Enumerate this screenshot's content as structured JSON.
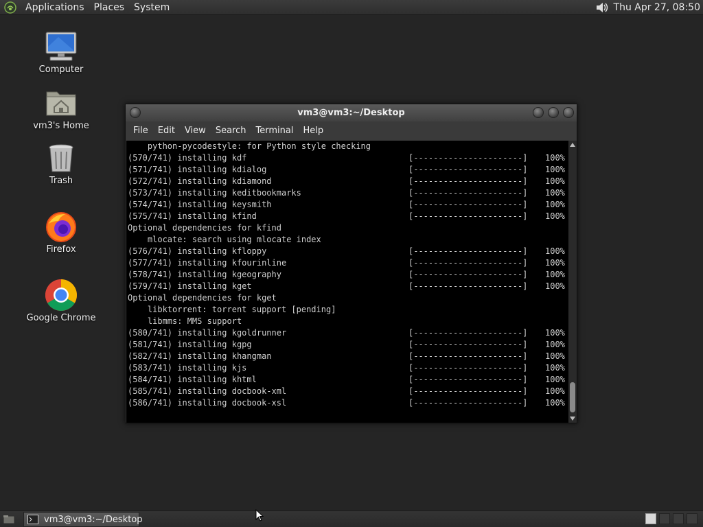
{
  "top_panel": {
    "menus": [
      "Applications",
      "Places",
      "System"
    ],
    "clock": "Thu Apr 27, 08:50",
    "icons": [
      "gnome-foot-icon",
      "volume-icon"
    ]
  },
  "desktop": {
    "icons": [
      {
        "label": "Computer",
        "icon": "computer-icon"
      },
      {
        "label": "vm3's Home",
        "icon": "home-folder-icon"
      },
      {
        "label": "Trash",
        "icon": "trash-icon"
      },
      {
        "label": "Firefox",
        "icon": "firefox-icon"
      },
      {
        "label": "Google Chrome",
        "icon": "chrome-icon"
      }
    ]
  },
  "terminal": {
    "title": "vm3@vm3:~/Desktop",
    "menu": [
      "File",
      "Edit",
      "View",
      "Search",
      "Terminal",
      "Help"
    ],
    "lines": [
      {
        "text": "    python-pycodestyle: for Python style checking",
        "bar": "",
        "pct": ""
      },
      {
        "text": "(570/741) installing kdf",
        "bar": "[----------------------]",
        "pct": "100%"
      },
      {
        "text": "(571/741) installing kdialog",
        "bar": "[----------------------]",
        "pct": "100%"
      },
      {
        "text": "(572/741) installing kdiamond",
        "bar": "[----------------------]",
        "pct": "100%"
      },
      {
        "text": "(573/741) installing keditbookmarks",
        "bar": "[----------------------]",
        "pct": "100%"
      },
      {
        "text": "(574/741) installing keysmith",
        "bar": "[----------------------]",
        "pct": "100%"
      },
      {
        "text": "(575/741) installing kfind",
        "bar": "[----------------------]",
        "pct": "100%"
      },
      {
        "text": "Optional dependencies for kfind",
        "bar": "",
        "pct": ""
      },
      {
        "text": "    mlocate: search using mlocate index",
        "bar": "",
        "pct": ""
      },
      {
        "text": "(576/741) installing kfloppy",
        "bar": "[----------------------]",
        "pct": "100%"
      },
      {
        "text": "(577/741) installing kfourinline",
        "bar": "[----------------------]",
        "pct": "100%"
      },
      {
        "text": "(578/741) installing kgeography",
        "bar": "[----------------------]",
        "pct": "100%"
      },
      {
        "text": "(579/741) installing kget",
        "bar": "[----------------------]",
        "pct": "100%"
      },
      {
        "text": "Optional dependencies for kget",
        "bar": "",
        "pct": ""
      },
      {
        "text": "    libktorrent: torrent support [pending]",
        "bar": "",
        "pct": ""
      },
      {
        "text": "    libmms: MMS support",
        "bar": "",
        "pct": ""
      },
      {
        "text": "(580/741) installing kgoldrunner",
        "bar": "[----------------------]",
        "pct": "100%"
      },
      {
        "text": "(581/741) installing kgpg",
        "bar": "[----------------------]",
        "pct": "100%"
      },
      {
        "text": "(582/741) installing khangman",
        "bar": "[----------------------]",
        "pct": "100%"
      },
      {
        "text": "(583/741) installing kjs",
        "bar": "[----------------------]",
        "pct": "100%"
      },
      {
        "text": "(584/741) installing khtml",
        "bar": "[----------------------]",
        "pct": "100%"
      },
      {
        "text": "(585/741) installing docbook-xml",
        "bar": "[----------------------]",
        "pct": "100%"
      },
      {
        "text": "(586/741) installing docbook-xsl",
        "bar": "[----------------------]",
        "pct": "100%"
      }
    ]
  },
  "taskbar": {
    "window_button": "vm3@vm3:~/Desktop",
    "workspaces": 4,
    "active_workspace": 1
  },
  "colors": {
    "desktop_bg": "#252525",
    "terminal_bg": "#000000",
    "terminal_fg": "#d0d0d0"
  }
}
